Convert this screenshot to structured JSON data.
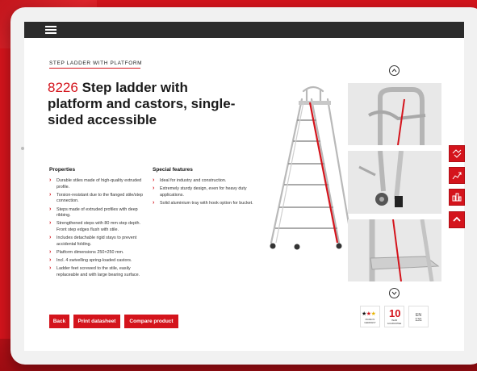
{
  "header": {
    "menu_icon": "hamburger-menu-icon"
  },
  "product": {
    "category": "STEP LADDER WITH PLATFORM",
    "number": "8226",
    "name": "Step ladder with platform and castors, single-sided accessible"
  },
  "properties": {
    "heading": "Properties",
    "items": [
      "Durable stiles made of high-quality extruded profile.",
      "Torsion-resistant due to the flanged stile/step connection.",
      "Steps made of extruded profiles with deep ribbing.",
      "Strengthened steps with 80 mm step depth. Front step edges flush with stile.",
      "Includes detachable rigid stays to prevent accidental folding.",
      "Platform dimensions 250×250 mm.",
      "Incl. 4 swivelling spring-loaded castors.",
      "Ladder feet screwed to the stile, easily replaceable and with large bearing surface."
    ]
  },
  "special": {
    "heading": "Special features",
    "items": [
      "Ideal for industry and construction.",
      "Extremely sturdy design, even for heavy duty applications.",
      "Solid aluminium tray with hook option for bucket."
    ]
  },
  "buttons": {
    "back": "Back",
    "print": "Print datasheet",
    "compare": "Compare product"
  },
  "gallery": {
    "up_icon": "chevron-up-icon",
    "down_icon": "chevron-down-icon",
    "thumbnails": [
      "handrail-detail",
      "castor-detail",
      "platform-detail"
    ]
  },
  "badges": {
    "made_in_line1": "MADE IN",
    "made_in_line2": "GERMANY",
    "warranty_number": "10",
    "warranty_line1": "YEAR",
    "warranty_line2": "GUARANTEE",
    "norm_line1": "EN",
    "norm_line2": "131"
  },
  "side_tabs": [
    "contact-icon",
    "dealer-icon",
    "compare-icon",
    "scroll-top-icon"
  ],
  "colors": {
    "accent": "#d4141c",
    "topbar": "#2b2b2b"
  }
}
